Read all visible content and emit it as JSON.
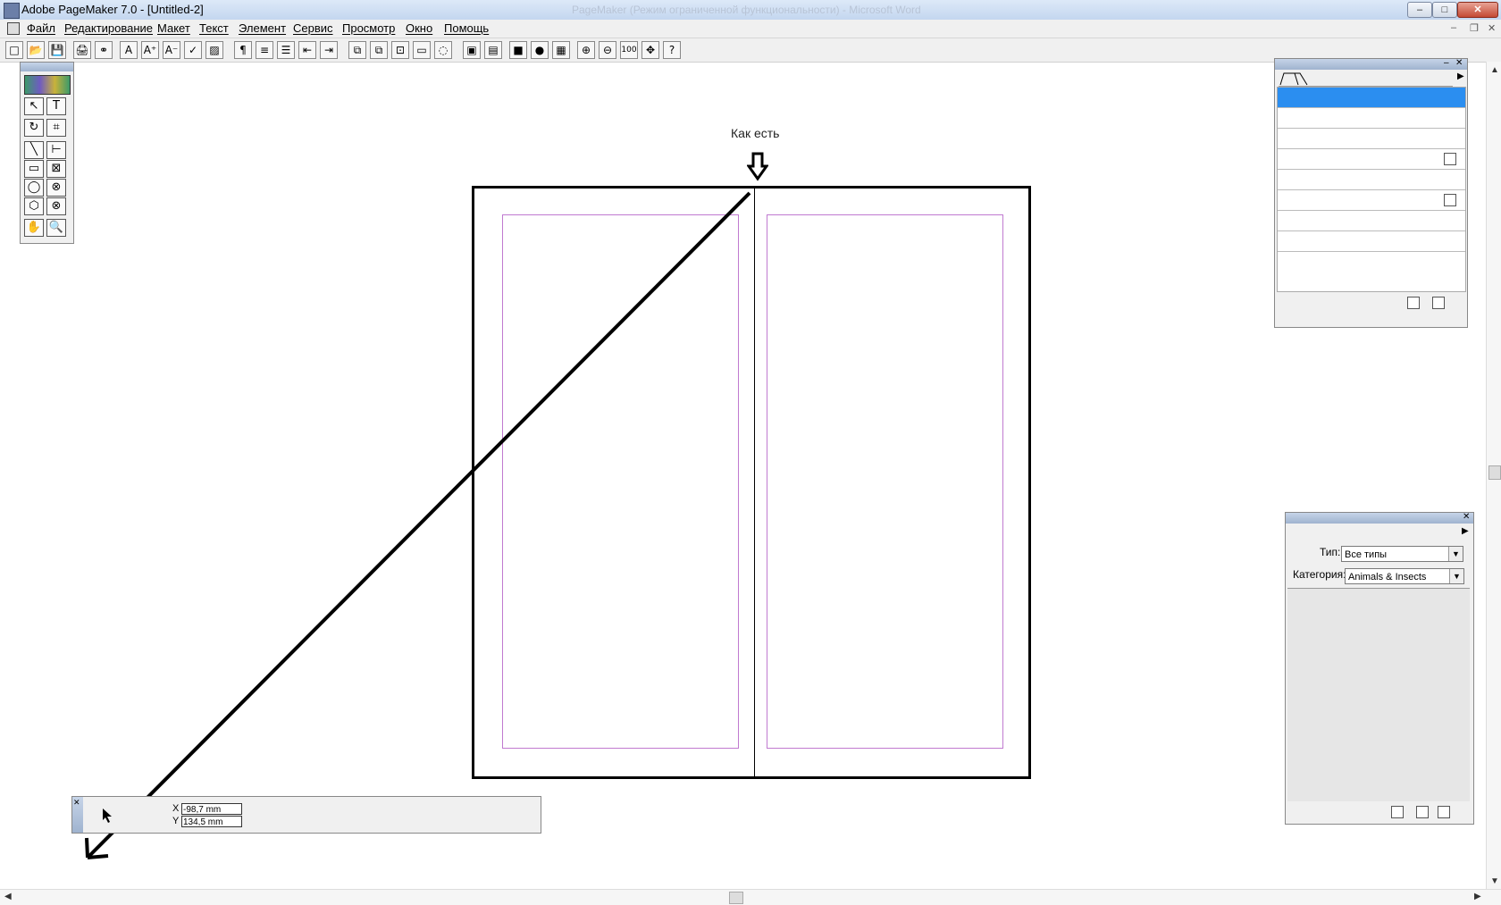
{
  "window": {
    "title": "Adobe PageMaker 7.0 - [Untitled-2]",
    "background_title": "PageMaker (Режим ограниченной функциональности) - Microsoft Word",
    "minimize": "–",
    "maximize": "□",
    "close": "✕"
  },
  "menu": {
    "items": [
      "Файл",
      "Редактирование",
      "Макет",
      "Текст",
      "Элемент",
      "Сервис",
      "Просмотр",
      "Окно",
      "Помощь"
    ],
    "mdi_minimize": "–",
    "mdi_restore": "❐",
    "mdi_close": "✕"
  },
  "toolbar": {
    "buttons": [
      "□",
      "📂",
      "💾",
      "🖨",
      "⚭",
      "A",
      "A⁺",
      "A⁻",
      "✓",
      "▨",
      "¶",
      "≡",
      "☰",
      "⇤",
      "⇥",
      "⧉",
      "⧉",
      "⊡",
      "▭",
      "◌",
      "▣",
      "▤",
      "■",
      "●",
      "▦",
      "⊕",
      "⊖",
      "100",
      "✥",
      "?"
    ]
  },
  "toolbox": {
    "tools": [
      "↖",
      "T",
      "↻",
      "⌗",
      "╲",
      "⊢",
      "▭",
      "⊠",
      "◯",
      "⊗",
      "⬡",
      "⊗",
      "✋",
      "🔍"
    ]
  },
  "canvas": {
    "caption": "Как есть"
  },
  "pages_panel": {
    "close": "✕",
    "minimize": "–",
    "menu_arrow": "▶"
  },
  "library_panel": {
    "close": "✕",
    "menu_arrow": "▶",
    "type_label": "Тип:",
    "type_value": "Все типы",
    "category_label": "Категория:",
    "category_value": "Animals & Insects"
  },
  "control_palette": {
    "close": "✕",
    "x_label": "X",
    "y_label": "Y",
    "x_value": "-98,7 mm",
    "y_value": "134,5 mm"
  }
}
